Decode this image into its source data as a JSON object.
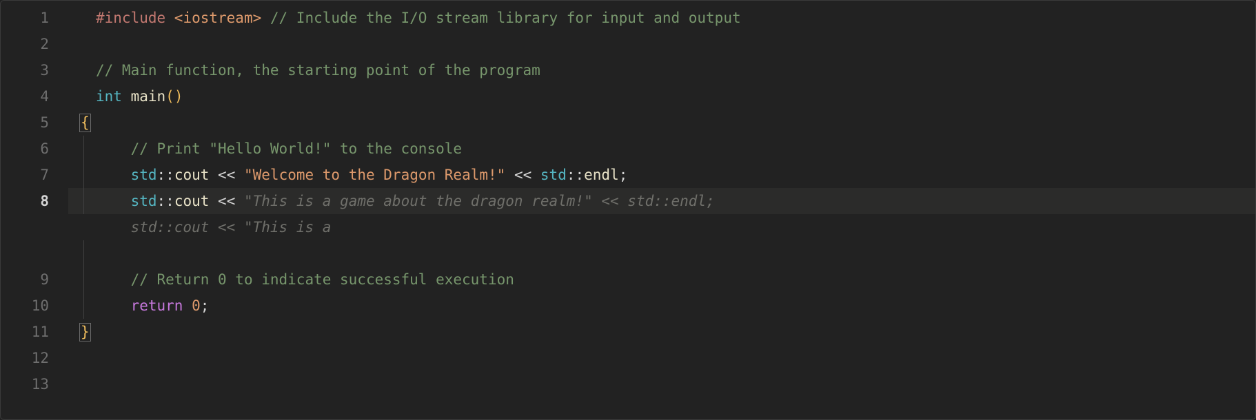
{
  "gutter": {
    "lines": [
      "1",
      "2",
      "3",
      "4",
      "5",
      "6",
      "7",
      "8",
      "9",
      "10",
      "11",
      "12",
      "13"
    ],
    "active_index": 7
  },
  "code": {
    "l1": {
      "include_directive": "#include",
      "include_header": " <iostream> ",
      "comment": "// Include the I/O stream library for input and output"
    },
    "l3": {
      "comment": "// Main function, the starting point of the program"
    },
    "l4": {
      "kw_int": "int",
      "sp1": " ",
      "fn_main": "main",
      "parens": "()"
    },
    "l5": {
      "brace": "{"
    },
    "l6": {
      "indent": "    ",
      "comment": "// Print \"Hello World!\" to the console"
    },
    "l7": {
      "indent": "    ",
      "ns": "std",
      "dcol": "::",
      "cout": "cout",
      "sp1": " ",
      "op1": "<<",
      "sp2": " ",
      "str": "\"Welcome to the Dragon Realm!\"",
      "sp3": " ",
      "op2": "<<",
      "sp4": " ",
      "ns2": "std",
      "dcol2": "::",
      "endl": "endl",
      "semi": ";"
    },
    "l8": {
      "indent": "    ",
      "ns": "std",
      "dcol": "::",
      "cout": "cout",
      "sp1": " ",
      "op1": "<<",
      "sp2": " ",
      "ghost_tail": "\"This is a game about the dragon realm!\" << std::endl;",
      "ghost_wrap": "std::cout << \"This is a"
    },
    "l10": {
      "indent": "    ",
      "comment": "// Return 0 to indicate successful execution"
    },
    "l11": {
      "indent": "    ",
      "kw_return": "return",
      "sp1": " ",
      "num": "0",
      "semi": ";"
    },
    "l12": {
      "brace": "}"
    }
  }
}
